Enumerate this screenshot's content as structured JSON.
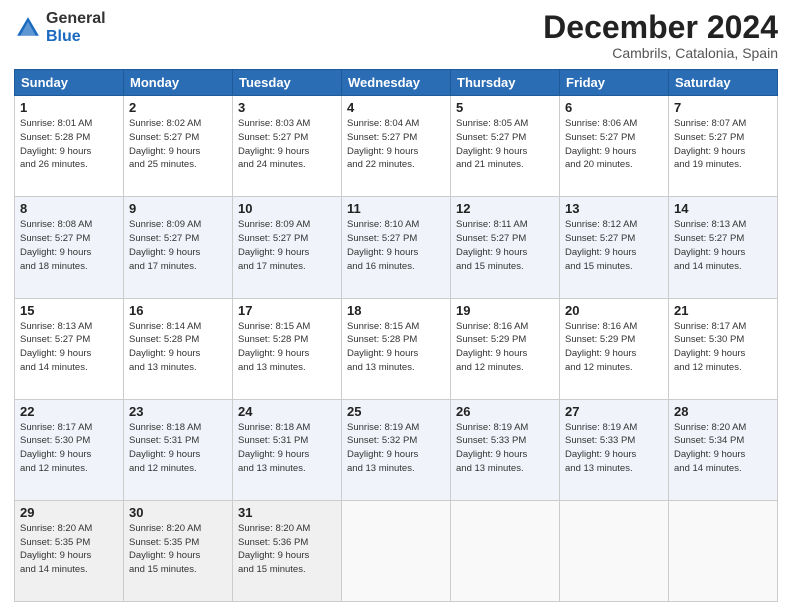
{
  "header": {
    "logo_general": "General",
    "logo_blue": "Blue",
    "month_title": "December 2024",
    "location": "Cambrils, Catalonia, Spain"
  },
  "days_of_week": [
    "Sunday",
    "Monday",
    "Tuesday",
    "Wednesday",
    "Thursday",
    "Friday",
    "Saturday"
  ],
  "weeks": [
    [
      {
        "day": "1",
        "info": "Sunrise: 8:01 AM\nSunset: 5:28 PM\nDaylight: 9 hours\nand 26 minutes."
      },
      {
        "day": "2",
        "info": "Sunrise: 8:02 AM\nSunset: 5:27 PM\nDaylight: 9 hours\nand 25 minutes."
      },
      {
        "day": "3",
        "info": "Sunrise: 8:03 AM\nSunset: 5:27 PM\nDaylight: 9 hours\nand 24 minutes."
      },
      {
        "day": "4",
        "info": "Sunrise: 8:04 AM\nSunset: 5:27 PM\nDaylight: 9 hours\nand 22 minutes."
      },
      {
        "day": "5",
        "info": "Sunrise: 8:05 AM\nSunset: 5:27 PM\nDaylight: 9 hours\nand 21 minutes."
      },
      {
        "day": "6",
        "info": "Sunrise: 8:06 AM\nSunset: 5:27 PM\nDaylight: 9 hours\nand 20 minutes."
      },
      {
        "day": "7",
        "info": "Sunrise: 8:07 AM\nSunset: 5:27 PM\nDaylight: 9 hours\nand 19 minutes."
      }
    ],
    [
      {
        "day": "8",
        "info": "Sunrise: 8:08 AM\nSunset: 5:27 PM\nDaylight: 9 hours\nand 18 minutes."
      },
      {
        "day": "9",
        "info": "Sunrise: 8:09 AM\nSunset: 5:27 PM\nDaylight: 9 hours\nand 17 minutes."
      },
      {
        "day": "10",
        "info": "Sunrise: 8:09 AM\nSunset: 5:27 PM\nDaylight: 9 hours\nand 17 minutes."
      },
      {
        "day": "11",
        "info": "Sunrise: 8:10 AM\nSunset: 5:27 PM\nDaylight: 9 hours\nand 16 minutes."
      },
      {
        "day": "12",
        "info": "Sunrise: 8:11 AM\nSunset: 5:27 PM\nDaylight: 9 hours\nand 15 minutes."
      },
      {
        "day": "13",
        "info": "Sunrise: 8:12 AM\nSunset: 5:27 PM\nDaylight: 9 hours\nand 15 minutes."
      },
      {
        "day": "14",
        "info": "Sunrise: 8:13 AM\nSunset: 5:27 PM\nDaylight: 9 hours\nand 14 minutes."
      }
    ],
    [
      {
        "day": "15",
        "info": "Sunrise: 8:13 AM\nSunset: 5:27 PM\nDaylight: 9 hours\nand 14 minutes."
      },
      {
        "day": "16",
        "info": "Sunrise: 8:14 AM\nSunset: 5:28 PM\nDaylight: 9 hours\nand 13 minutes."
      },
      {
        "day": "17",
        "info": "Sunrise: 8:15 AM\nSunset: 5:28 PM\nDaylight: 9 hours\nand 13 minutes."
      },
      {
        "day": "18",
        "info": "Sunrise: 8:15 AM\nSunset: 5:28 PM\nDaylight: 9 hours\nand 13 minutes."
      },
      {
        "day": "19",
        "info": "Sunrise: 8:16 AM\nSunset: 5:29 PM\nDaylight: 9 hours\nand 12 minutes."
      },
      {
        "day": "20",
        "info": "Sunrise: 8:16 AM\nSunset: 5:29 PM\nDaylight: 9 hours\nand 12 minutes."
      },
      {
        "day": "21",
        "info": "Sunrise: 8:17 AM\nSunset: 5:30 PM\nDaylight: 9 hours\nand 12 minutes."
      }
    ],
    [
      {
        "day": "22",
        "info": "Sunrise: 8:17 AM\nSunset: 5:30 PM\nDaylight: 9 hours\nand 12 minutes."
      },
      {
        "day": "23",
        "info": "Sunrise: 8:18 AM\nSunset: 5:31 PM\nDaylight: 9 hours\nand 12 minutes."
      },
      {
        "day": "24",
        "info": "Sunrise: 8:18 AM\nSunset: 5:31 PM\nDaylight: 9 hours\nand 13 minutes."
      },
      {
        "day": "25",
        "info": "Sunrise: 8:19 AM\nSunset: 5:32 PM\nDaylight: 9 hours\nand 13 minutes."
      },
      {
        "day": "26",
        "info": "Sunrise: 8:19 AM\nSunset: 5:33 PM\nDaylight: 9 hours\nand 13 minutes."
      },
      {
        "day": "27",
        "info": "Sunrise: 8:19 AM\nSunset: 5:33 PM\nDaylight: 9 hours\nand 13 minutes."
      },
      {
        "day": "28",
        "info": "Sunrise: 8:20 AM\nSunset: 5:34 PM\nDaylight: 9 hours\nand 14 minutes."
      }
    ],
    [
      {
        "day": "29",
        "info": "Sunrise: 8:20 AM\nSunset: 5:35 PM\nDaylight: 9 hours\nand 14 minutes."
      },
      {
        "day": "30",
        "info": "Sunrise: 8:20 AM\nSunset: 5:35 PM\nDaylight: 9 hours\nand 15 minutes."
      },
      {
        "day": "31",
        "info": "Sunrise: 8:20 AM\nSunset: 5:36 PM\nDaylight: 9 hours\nand 15 minutes."
      },
      null,
      null,
      null,
      null
    ]
  ]
}
